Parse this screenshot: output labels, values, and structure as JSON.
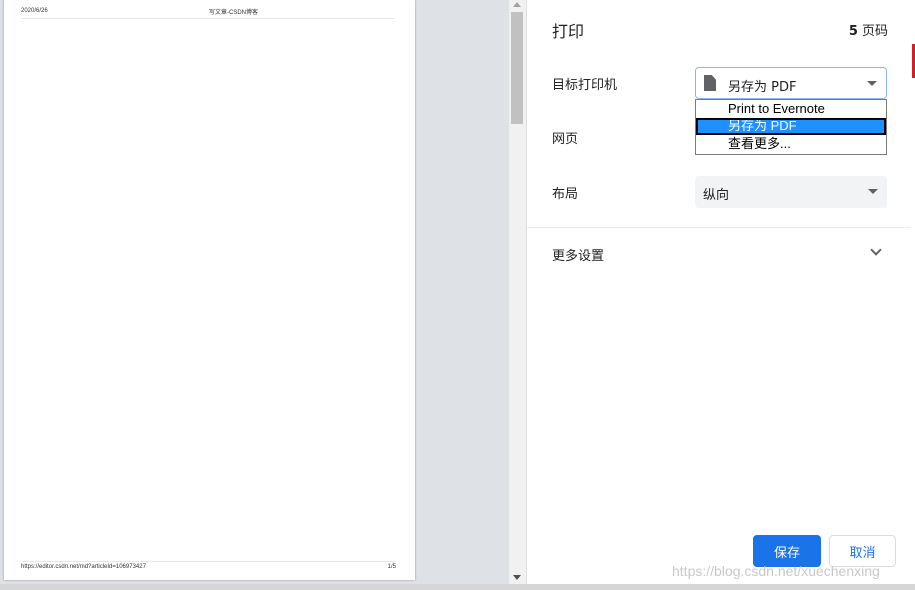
{
  "preview": {
    "header_date": "2020/6/26",
    "header_title": "写文章-CSDN博客",
    "footer_url": "https://editor.csdn.net/md?articleId=106973427",
    "footer_page": "1/5"
  },
  "panel": {
    "title": "打印",
    "page_count_num": "5",
    "page_count_unit": " 页码",
    "destination_label": "目标打印机",
    "destination_value": "另存为 PDF",
    "destination_options": [
      "Print to Evernote",
      "另存为 PDF",
      "查看更多..."
    ],
    "pages_label": "网页",
    "layout_label": "布局",
    "layout_value": "纵向",
    "more_settings_label": "更多设置",
    "save_label": "保存",
    "cancel_label": "取消"
  },
  "watermark": "https://blog.csdn.net/xuechenxing",
  "colors": {
    "accent": "#1a73e8",
    "selected_option": "#1e90ff"
  }
}
